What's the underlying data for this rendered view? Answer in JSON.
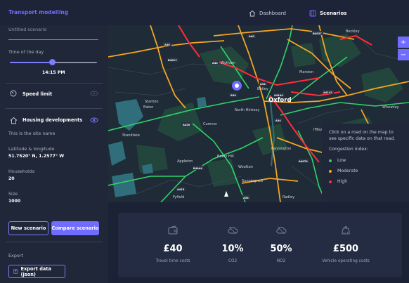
{
  "app": {
    "brand": "Transport modelling",
    "nav": [
      {
        "label": "Dashboard",
        "icon": "home-icon",
        "active": false
      },
      {
        "label": "Scenarios",
        "icon": "scenarios-icon",
        "active": true
      }
    ]
  },
  "sidebar": {
    "scenario_name": "Untitled scenario",
    "time_label": "Time of the day",
    "time_value": "14:15 PM",
    "time_slider_fraction": 0.48,
    "speed_limit": {
      "label": "Speed limit",
      "icon": "speedometer-icon"
    },
    "housing": {
      "label": "Housing developments",
      "icon": "house-icon",
      "site_name": "This is the site name",
      "latlng_label": "Latitude & longitude",
      "latlng_value": "51.7520° N, 1.2577° W",
      "households_label": "Households",
      "households_value": "20",
      "size_label": "Size",
      "size_value": "1000"
    },
    "buttons": {
      "new": "New scenario",
      "compare": "Compare scenario"
    },
    "export_label": "Export",
    "export_button": "Export data (json)"
  },
  "map": {
    "places": {
      "oxford": "Oxford",
      "wytham": "Wytham",
      "botley": "Botley",
      "north_hinksey": "North Hinksey",
      "cumnor": "Cumnor",
      "boars_hill": "Boars Hill",
      "wootton": "Wootton",
      "kennington": "Kennington",
      "sunningwell": "Sunningwell",
      "appleton": "Appleton",
      "standlake": "Standlake",
      "fyfield": "Fyfield",
      "radley": "Radley",
      "wheatley": "Wheatley",
      "stanton": "Stanton",
      "eaton": "Eaton",
      "marston": "Marston",
      "iffley": "Iffley",
      "beckley": "Beckley"
    },
    "roads": {
      "a40": "A40",
      "a34": "A34",
      "a44": "A44",
      "a420": "A420",
      "a415": "A415",
      "a4142": "A4142",
      "a4074": "A4074",
      "a4144": "A4144",
      "b4044": "B4044",
      "b4017": "B4017",
      "b4027": "B4027"
    },
    "zoom_in": "+",
    "zoom_out": "−"
  },
  "legend": {
    "hint": "Click on a road on the map to see specific data on that road.",
    "title": "Congestion index:",
    "items": [
      {
        "label": "Low",
        "color": "#2fd36a"
      },
      {
        "label": "Moderate",
        "color": "#f5a623"
      },
      {
        "label": "High",
        "color": "#ff2d3a"
      }
    ]
  },
  "stats": [
    {
      "value": "£40",
      "label": "Travel time costs",
      "icon": "wallet-icon"
    },
    {
      "value": "10%",
      "label": "CO2",
      "icon": "cloud-icon"
    },
    {
      "value": "50%",
      "label": "NO2",
      "icon": "cloud-icon"
    },
    {
      "value": "£500",
      "label": "Vehicle operating costs",
      "icon": "car-icon"
    }
  ],
  "colors": {
    "accent": "#6f6cff",
    "panel": "#1f2739",
    "background": "#1b2236"
  }
}
